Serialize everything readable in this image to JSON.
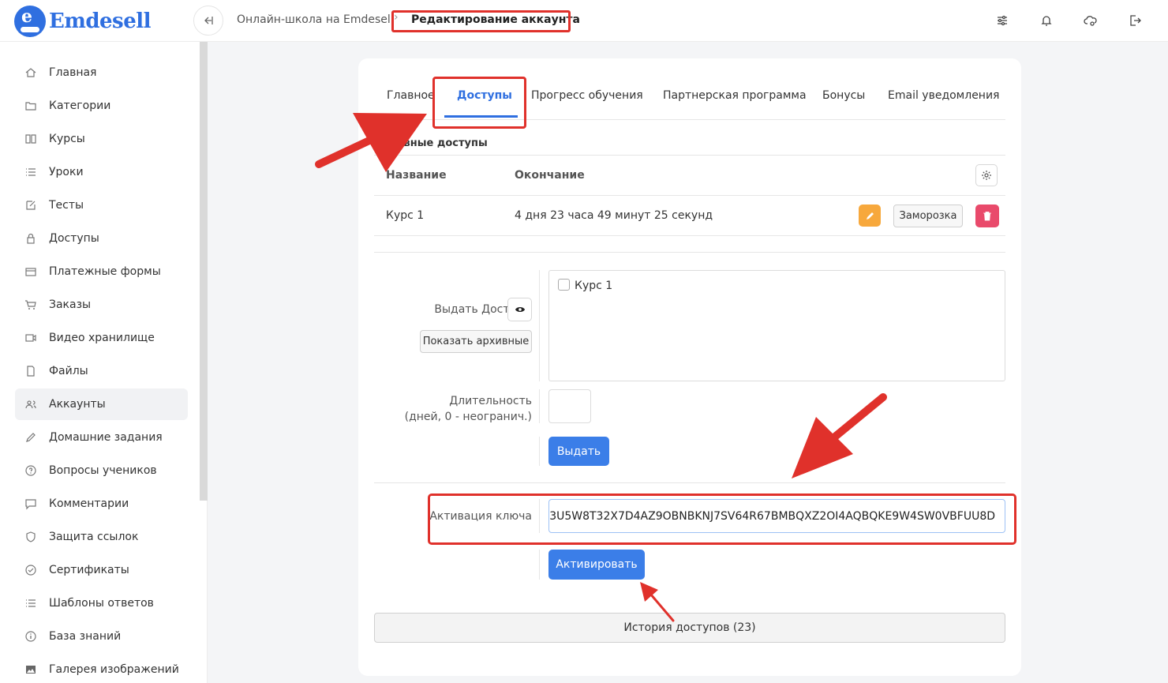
{
  "header": {
    "logo_text": "Emdesell",
    "breadcrumb_root": "Онлайн-школа на Emdesell",
    "breadcrumb_current": "Редактирование аккаунта",
    "icons": [
      "sliders-icon",
      "bell-icon",
      "cloud-gear-icon",
      "logout-icon"
    ]
  },
  "sidebar": {
    "items": [
      {
        "label": "Главная",
        "icon": "home-icon"
      },
      {
        "label": "Категории",
        "icon": "folder-icon"
      },
      {
        "label": "Курсы",
        "icon": "book-icon"
      },
      {
        "label": "Уроки",
        "icon": "list-icon"
      },
      {
        "label": "Тесты",
        "icon": "edit-icon"
      },
      {
        "label": "Доступы",
        "icon": "lock-icon"
      },
      {
        "label": "Платежные формы",
        "icon": "card-icon"
      },
      {
        "label": "Заказы",
        "icon": "cart-icon"
      },
      {
        "label": "Видео хранилище",
        "icon": "video-icon"
      },
      {
        "label": "Файлы",
        "icon": "file-icon"
      },
      {
        "label": "Аккаунты",
        "icon": "users-icon"
      },
      {
        "label": "Домашние задания",
        "icon": "pencil-icon"
      },
      {
        "label": "Вопросы учеников",
        "icon": "question-icon"
      },
      {
        "label": "Комментарии",
        "icon": "comment-icon"
      },
      {
        "label": "Защита ссылок",
        "icon": "shield-icon"
      },
      {
        "label": "Сертификаты",
        "icon": "check-circle-icon"
      },
      {
        "label": "Шаблоны ответов",
        "icon": "list-icon"
      },
      {
        "label": "База знаний",
        "icon": "info-icon"
      },
      {
        "label": "Галерея изображений",
        "icon": "image-icon"
      }
    ],
    "active_label": "Аккаунты"
  },
  "tabs": [
    {
      "label": "Главное"
    },
    {
      "label": "Доступы"
    },
    {
      "label": "Прогресс обучения"
    },
    {
      "label": "Партнерская программа"
    },
    {
      "label": "Бонусы"
    },
    {
      "label": "Email уведомления"
    }
  ],
  "active_tab": "Доступы",
  "accesses": {
    "section_title": "Активные доступы",
    "columns": [
      "Название",
      "Окончание"
    ],
    "rows": [
      {
        "name": "Курс 1",
        "ends": "4 дня 23 часа 49 минут 25 секунд",
        "freeze_label": "Заморозка"
      }
    ]
  },
  "grant": {
    "label": "Выдать Доступы",
    "show_archived": "Показать архивные",
    "options": [
      {
        "label": "Курс 1",
        "checked": false
      }
    ],
    "duration_label_1": "Длительность",
    "duration_label_2": "(дней, 0 - неогранич.)",
    "duration_value": "",
    "submit": "Выдать"
  },
  "key": {
    "label": "Активация ключа",
    "value": "3U5W8T32X7D4AZ9OBNBKNJ7SV64R67BMBQXZ2OI4AQBQKE9W4SW0VBFUU8D",
    "submit": "Активировать"
  },
  "history_button": "История доступов (23)",
  "annotation_color": "#e0312b"
}
